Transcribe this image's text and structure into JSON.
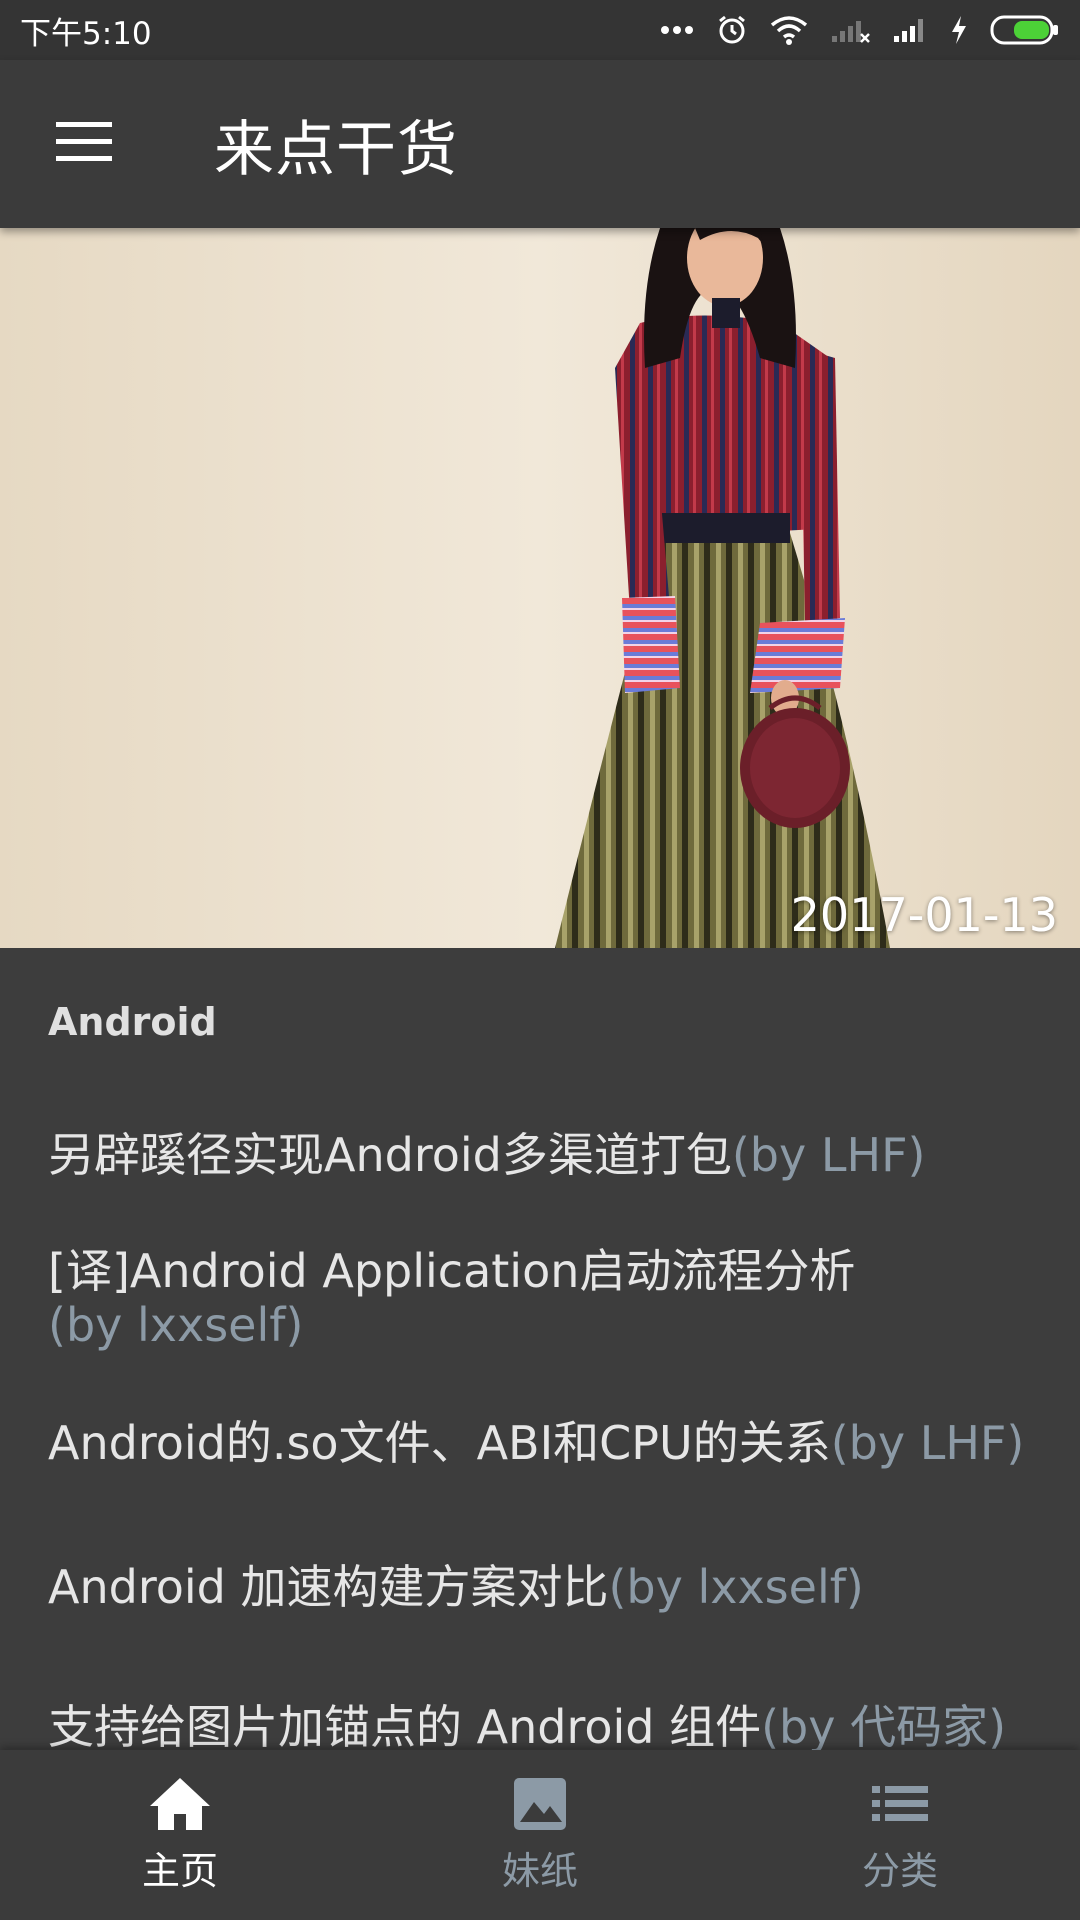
{
  "status_bar": {
    "time": "下午5:10",
    "icons": [
      "more-dots-icon",
      "alarm-icon",
      "wifi-icon",
      "signal-x-icon",
      "signal-icon",
      "charging-icon",
      "battery-icon"
    ]
  },
  "app_bar": {
    "title": "来点干货",
    "menu_icon": "hamburger-menu-icon"
  },
  "hero": {
    "date": "2017-01-13"
  },
  "section": {
    "title": "Android"
  },
  "articles": [
    {
      "title": "另辟蹊径实现Android多渠道打包",
      "author": "(by LHF)"
    },
    {
      "title": "[译]Android Application启动流程分析",
      "author": "(by lxxself)"
    },
    {
      "title": "Android的.so文件、ABI和CPU的关系",
      "author": "(by LHF)"
    },
    {
      "title": "Android 加速构建方案对比",
      "author": "(by lxxself)"
    },
    {
      "title": "支持给图片加锚点的 Android 组件",
      "author": "(by 代码家)"
    }
  ],
  "bottom_nav": {
    "items": [
      {
        "label": "主页",
        "icon": "home-icon",
        "active": true
      },
      {
        "label": "妹纸",
        "icon": "image-icon",
        "active": false
      },
      {
        "label": "分类",
        "icon": "list-icon",
        "active": false
      }
    ]
  },
  "colors": {
    "background": "#3d3d3d",
    "app_bar": "#3b3b3b",
    "author_text": "#8c9aa6",
    "battery": "#4cd137"
  }
}
